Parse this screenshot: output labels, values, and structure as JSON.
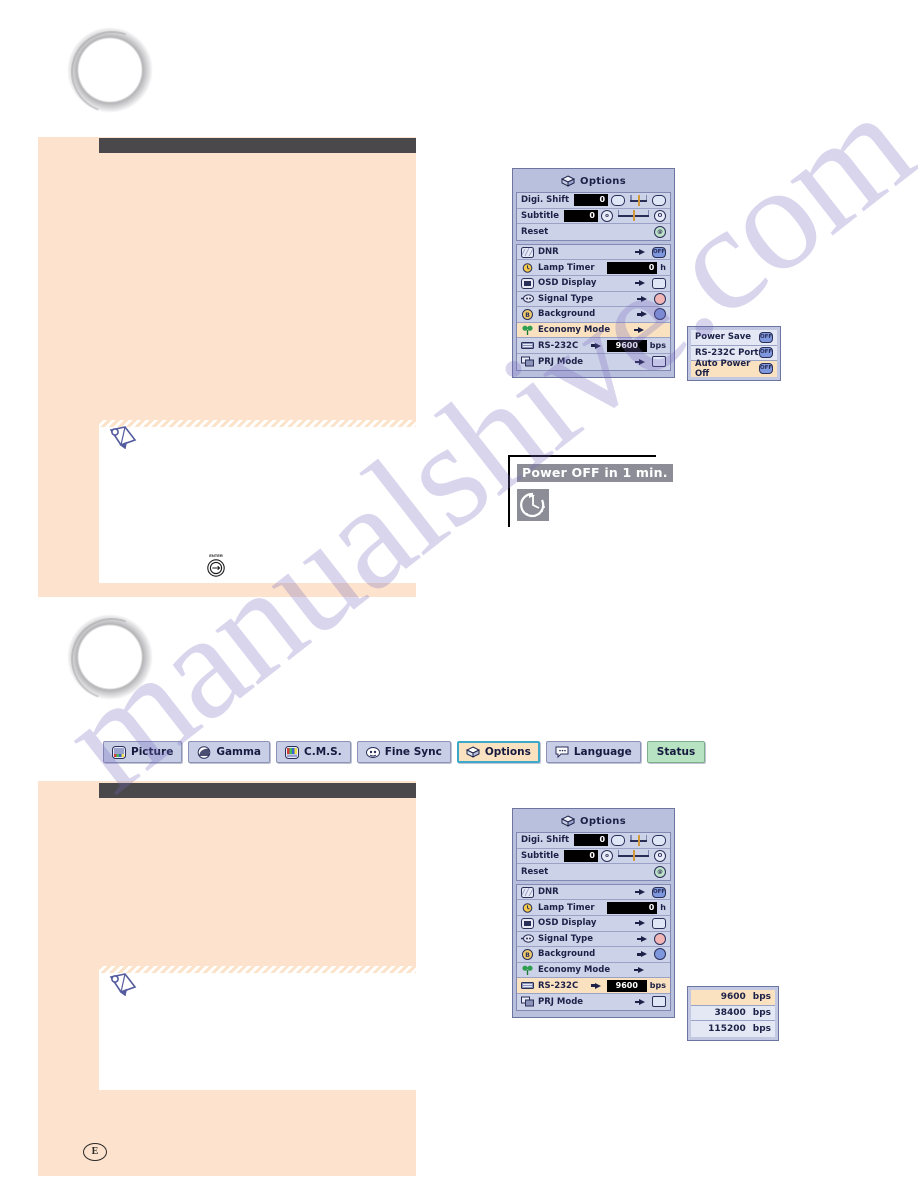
{
  "page": {
    "marker": "E",
    "watermark": "manualshive.com"
  },
  "sections": [
    {
      "id": "economy-mode",
      "note": {
        "icon": "pencil-icon",
        "enter_button_label": "ENTER"
      }
    },
    {
      "id": "rs232c",
      "note": {
        "icon": "pencil-icon"
      }
    }
  ],
  "tabs": [
    {
      "label": "Picture",
      "icon": "picture-icon",
      "state": "normal"
    },
    {
      "label": "Gamma",
      "icon": "gamma-icon",
      "state": "normal"
    },
    {
      "label": "C.M.S.",
      "icon": "cms-icon",
      "state": "normal"
    },
    {
      "label": "Fine Sync",
      "icon": "fine-sync-icon",
      "state": "normal"
    },
    {
      "label": "Options",
      "icon": "options-icon",
      "state": "active"
    },
    {
      "label": "Language",
      "icon": "language-icon",
      "state": "normal"
    },
    {
      "label": "Status",
      "icon": "status-icon",
      "state": "status"
    }
  ],
  "osd_menu_top": {
    "title": "Options",
    "title_icon": "options-cube-icon",
    "adjust_rows": [
      {
        "label": "Digi. Shift",
        "value": "0",
        "left_icon": "shift-down-icon",
        "right_icon": "shift-up-icon"
      },
      {
        "label": "Subtitle",
        "value": "0",
        "left_icon": "subtitle-icon",
        "right_icon": "subtitle-off-icon"
      }
    ],
    "reset": {
      "label": "Reset",
      "icon": "reset-icon"
    },
    "items": [
      {
        "label": "DNR",
        "icon": "dnr-icon",
        "arrow": true,
        "value_glyph": "OFF",
        "highlight": false
      },
      {
        "label": "Lamp Timer",
        "icon": "lamp-timer-icon",
        "arrow": false,
        "value": "0",
        "unit": "h",
        "highlight": false
      },
      {
        "label": "OSD Display",
        "icon": "osd-display-icon",
        "arrow": true,
        "value_glyph": "grid",
        "highlight": false
      },
      {
        "label": "Signal Type",
        "icon": "signal-type-icon",
        "arrow": true,
        "value_glyph": "signal",
        "highlight": false
      },
      {
        "label": "Background",
        "icon": "background-icon",
        "arrow": true,
        "value_glyph": "blue",
        "highlight": false
      },
      {
        "label": "Economy Mode",
        "icon": "economy-icon",
        "arrow": true,
        "value_glyph": "",
        "highlight": true
      },
      {
        "label": "RS-232C",
        "icon": "rs232c-icon",
        "arrow": true,
        "value": "9600",
        "unit": "bps",
        "highlight": false
      },
      {
        "label": "PRJ Mode",
        "icon": "prj-mode-icon",
        "arrow": true,
        "value_glyph": "screen",
        "highlight": false
      }
    ]
  },
  "economy_submenu": {
    "rows": [
      {
        "label": "Power Save",
        "glyph": "OFF",
        "highlight": false
      },
      {
        "label": "RS-232C Port",
        "glyph": "OFF",
        "highlight": false
      },
      {
        "label": "Auto Power Off",
        "glyph": "OFF",
        "highlight": true
      }
    ]
  },
  "power_off_warning": {
    "message": "Power OFF in 1 min.",
    "icon": "clock-countdown-icon"
  },
  "osd_menu_bottom": {
    "title": "Options",
    "title_icon": "options-cube-icon",
    "adjust_rows": [
      {
        "label": "Digi. Shift",
        "value": "0",
        "left_icon": "shift-down-icon",
        "right_icon": "shift-up-icon"
      },
      {
        "label": "Subtitle",
        "value": "0",
        "left_icon": "subtitle-icon",
        "right_icon": "subtitle-off-icon"
      }
    ],
    "reset": {
      "label": "Reset",
      "icon": "reset-icon"
    },
    "items": [
      {
        "label": "DNR",
        "icon": "dnr-icon",
        "arrow": true,
        "value_glyph": "OFF",
        "highlight": false
      },
      {
        "label": "Lamp Timer",
        "icon": "lamp-timer-icon",
        "arrow": false,
        "value": "0",
        "unit": "h",
        "highlight": false
      },
      {
        "label": "OSD Display",
        "icon": "osd-display-icon",
        "arrow": true,
        "value_glyph": "grid",
        "highlight": false
      },
      {
        "label": "Signal Type",
        "icon": "signal-type-icon",
        "arrow": true,
        "value_glyph": "signal",
        "highlight": false
      },
      {
        "label": "Background",
        "icon": "background-icon",
        "arrow": true,
        "value_glyph": "blue",
        "highlight": false
      },
      {
        "label": "Economy Mode",
        "icon": "economy-icon",
        "arrow": true,
        "value_glyph": "",
        "highlight": false
      },
      {
        "label": "RS-232C",
        "icon": "rs232c-icon",
        "arrow": true,
        "value": "9600",
        "unit": "bps",
        "highlight": true
      },
      {
        "label": "PRJ Mode",
        "icon": "prj-mode-icon",
        "arrow": true,
        "value_glyph": "screen",
        "highlight": false
      }
    ]
  },
  "baud_submenu": {
    "rows": [
      {
        "value": "9600",
        "unit": "bps",
        "highlight": true
      },
      {
        "value": "38400",
        "unit": "bps",
        "highlight": false
      },
      {
        "value": "115200",
        "unit": "bps",
        "highlight": false
      }
    ]
  }
}
